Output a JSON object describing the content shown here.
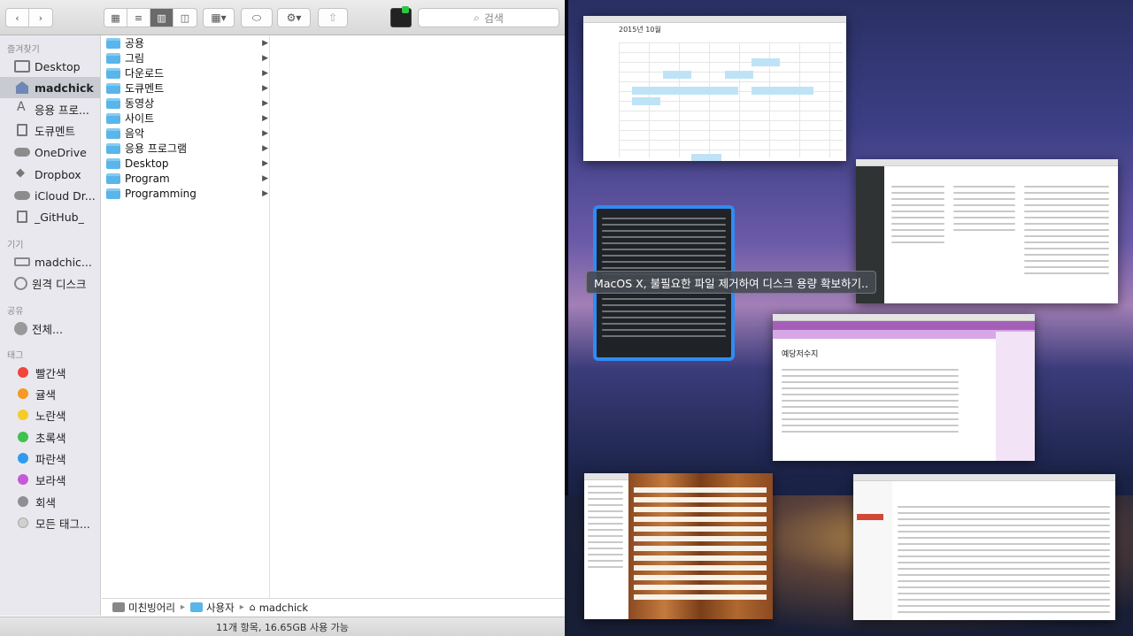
{
  "toolbar": {
    "search_placeholder": "검색",
    "search_icon": "magnifier-icon",
    "view_modes": [
      "icon-view",
      "list-view",
      "column-view",
      "cover-flow-view"
    ],
    "active_view": "column-view"
  },
  "sidebar": {
    "favorites_header": "즐겨찾기",
    "favorites": [
      {
        "label": "Desktop",
        "icon": "desktop-icon"
      },
      {
        "label": "madchick",
        "icon": "home-icon",
        "selected": true
      },
      {
        "label": "응용 프로...",
        "icon": "applications-icon"
      },
      {
        "label": "도큐멘트",
        "icon": "documents-icon"
      },
      {
        "label": "OneDrive",
        "icon": "cloud-icon"
      },
      {
        "label": "Dropbox",
        "icon": "dropbox-icon"
      },
      {
        "label": "iCloud Dr...",
        "icon": "cloud-icon"
      },
      {
        "label": "_GitHub_",
        "icon": "folder-icon"
      }
    ],
    "devices_header": "기기",
    "devices": [
      {
        "label": "madchic...",
        "icon": "laptop-icon"
      },
      {
        "label": "원격 디스크",
        "icon": "disc-icon"
      }
    ],
    "shared_header": "공유",
    "shared": [
      {
        "label": "전체...",
        "icon": "globe-icon"
      }
    ],
    "tags_header": "태그",
    "tags": [
      {
        "label": "빨간색",
        "color": "#f0453a"
      },
      {
        "label": "귤색",
        "color": "#f59a24"
      },
      {
        "label": "노란색",
        "color": "#f5cc2a"
      },
      {
        "label": "초록색",
        "color": "#3ec24b"
      },
      {
        "label": "파란색",
        "color": "#2f9bf0"
      },
      {
        "label": "보라색",
        "color": "#c659d6"
      },
      {
        "label": "회색",
        "color": "#8e8e93"
      },
      {
        "label": "모든 태그...",
        "color": "#d0d0d0"
      }
    ]
  },
  "files": [
    "공용",
    "그림",
    "다운로드",
    "도큐멘트",
    "동영상",
    "사이트",
    "음악",
    "응용 프로그램",
    "Desktop",
    "Program",
    "Programming"
  ],
  "path": {
    "items": [
      "미친빙어리",
      "사용자",
      "madchick"
    ]
  },
  "status": "11개 항목, 16.65GB 사용 가능",
  "mission_control": {
    "selected_window_title": "MacOS X, 불필요한 파일 제거하여 디스크 용량 확보하기..",
    "calendar_month": "2015년 10월",
    "note_title": "예당저수지"
  }
}
